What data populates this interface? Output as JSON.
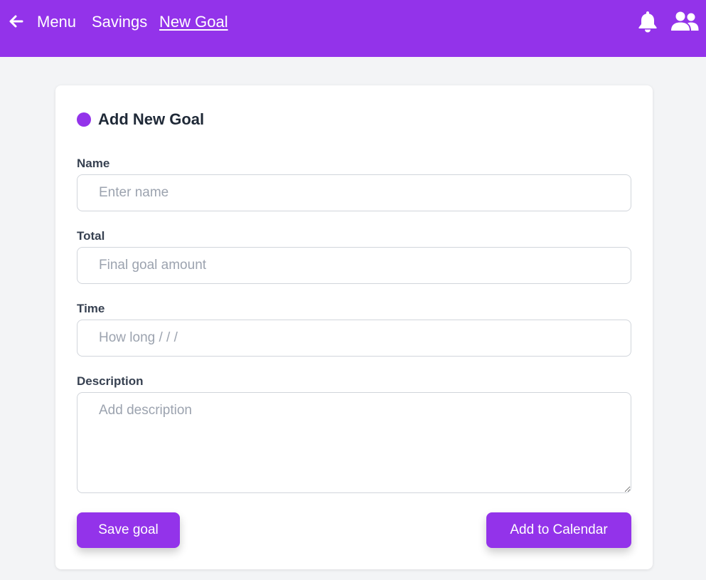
{
  "header": {
    "back_icon": "arrow-left-icon",
    "nav": {
      "menu": "Menu",
      "savings": "Savings",
      "current": "New Goal"
    },
    "notifications_icon": "bell-icon",
    "users_icon": "users-icon"
  },
  "form": {
    "title": "Add New Goal",
    "fields": {
      "name": {
        "label": "Name",
        "placeholder": "Enter name",
        "value": ""
      },
      "total": {
        "label": "Total",
        "placeholder": "Final goal amount",
        "value": ""
      },
      "time": {
        "label": "Time",
        "placeholder": "How long / / /",
        "value": ""
      },
      "description": {
        "label": "Description",
        "placeholder": "Add description",
        "value": ""
      }
    },
    "buttons": {
      "save": "Save goal",
      "calendar": "Add to Calendar"
    }
  },
  "colors": {
    "accent": "#9333ea",
    "background": "#f3f4f6"
  }
}
